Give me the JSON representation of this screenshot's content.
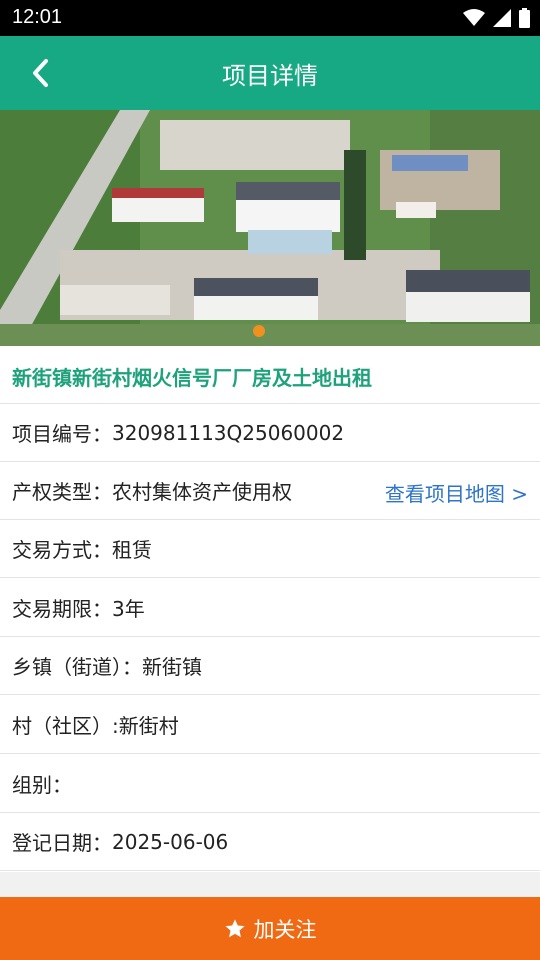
{
  "status_bar": {
    "time": "12:01",
    "icons": [
      "wifi-icon",
      "signal-icon",
      "battery-icon"
    ]
  },
  "app_bar": {
    "title": "项目详情",
    "back_icon": "back-arrow-icon"
  },
  "banner": {
    "image": "aerial photo of factory buildings and land",
    "carousel_index": 1,
    "carousel_count": 1,
    "indicator_color": "#f0901e"
  },
  "project": {
    "title": "新街镇新街村烟火信号厂厂房及土地出租"
  },
  "details": {
    "code": {
      "label": "项目编号：",
      "value": "320981113Q25060002"
    },
    "property_type": {
      "label": "产权类型：",
      "value": "农村集体资产使用权",
      "map_link": "查看项目地图 >"
    },
    "trade_method": {
      "label": "交易方式：",
      "value": "租赁"
    },
    "trade_term": {
      "label": "交易期限：",
      "value": "3年"
    },
    "town": {
      "label": "乡镇（街道）：",
      "value": "新街镇"
    },
    "village": {
      "label": "村（社区）:",
      "value": "新街村"
    },
    "group": {
      "label": "组别：",
      "value": ""
    },
    "register_date": {
      "label": "登记日期：",
      "value": "2025-06-06"
    }
  },
  "footer": {
    "follow_label": "加关注",
    "follow_icon": "star-icon"
  },
  "colors": {
    "primary": "#17a884",
    "title_green": "#1ea27c",
    "link_blue": "#2e74c9",
    "action_orange": "#f06a14"
  }
}
